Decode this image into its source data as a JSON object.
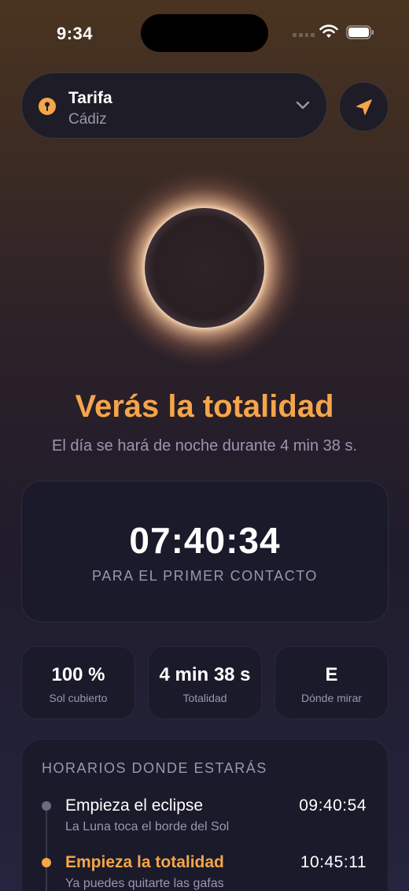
{
  "status_bar": {
    "time": "9:34"
  },
  "location": {
    "name": "Tarifa",
    "region": "Cádiz"
  },
  "headline": "Verás la totalidad",
  "subline": "El día se hará de noche durante 4 min 38 s.",
  "countdown": {
    "time": "07:40:34",
    "label": "PARA EL PRIMER CONTACTO"
  },
  "stats": [
    {
      "value": "100 %",
      "label": "Sol cubierto"
    },
    {
      "value": "4 min 38 s",
      "label": "Totalidad"
    },
    {
      "value": "E",
      "label": "Dónde mirar"
    }
  ],
  "schedule": {
    "title": "HORARIOS DONDE ESTARÁS",
    "events": [
      {
        "title": "Empieza el eclipse",
        "description": "La Luna toca el borde del Sol",
        "time": "09:40:54"
      },
      {
        "title": "Empieza la totalidad",
        "description": "Ya puedes quitarte las gafas",
        "time": "10:45:11"
      }
    ]
  },
  "colors": {
    "accent": "#f5a54a",
    "card": "#1a1a2a",
    "muted": "#9a96b0"
  }
}
